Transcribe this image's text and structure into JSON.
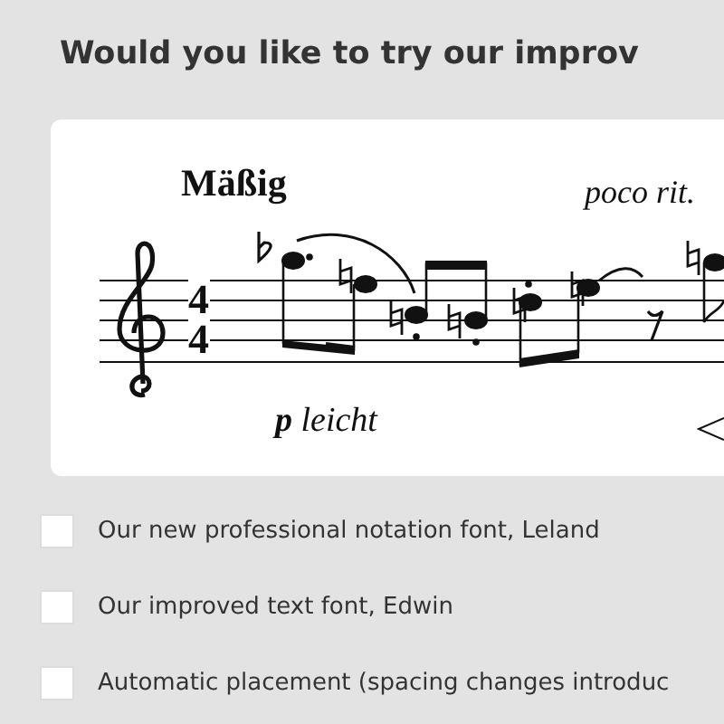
{
  "title": "Would you like to try our improv",
  "preview": {
    "tempo": "Mäßig",
    "expression": "poco rit.",
    "dynamic": "**p** leicht",
    "time_signature": {
      "numerator": "4",
      "denominator": "4"
    }
  },
  "options": [
    {
      "label": "Our new professional notation font, Leland",
      "checked": false
    },
    {
      "label": "Our improved text font, Edwin",
      "checked": false
    },
    {
      "label": "Automatic placement (spacing changes introduc",
      "checked": false
    }
  ]
}
